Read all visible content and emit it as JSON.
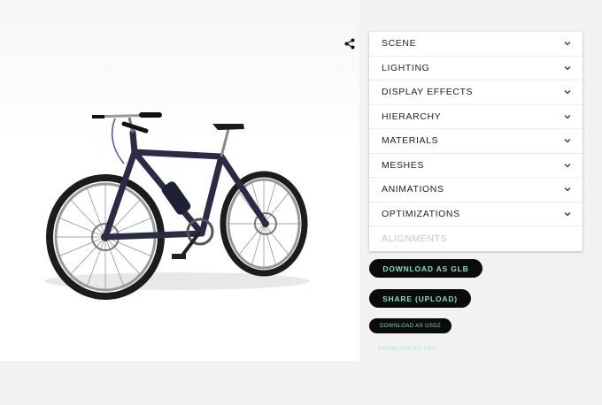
{
  "panel": {
    "sections": [
      {
        "label": "SCENE",
        "enabled": true
      },
      {
        "label": "LIGHTING",
        "enabled": true
      },
      {
        "label": "DISPLAY EFFECTS",
        "enabled": true
      },
      {
        "label": "HIERARCHY",
        "enabled": true
      },
      {
        "label": "MATERIALS",
        "enabled": true
      },
      {
        "label": "MESHES",
        "enabled": true
      },
      {
        "label": "ANIMATIONS",
        "enabled": true
      },
      {
        "label": "OPTIMIZATIONS",
        "enabled": true
      },
      {
        "label": "ALIGNMENTS",
        "enabled": false
      }
    ]
  },
  "actions": {
    "download_glb": "DOWNLOAD AS GLB",
    "share_upload": "SHARE (UPLOAD)",
    "download_usdz": "DOWNLOAD AS USDZ",
    "download_obj": "DOWNLOAD AS OBJ"
  },
  "icons": {
    "share": "share-icon",
    "chevron": "chevron-down-icon"
  },
  "colors": {
    "button_bg": "#0b0b0b",
    "button_text": "#7de0c4",
    "disabled_text": "#c4c4c4",
    "bike_frame": "#2a2c45"
  }
}
